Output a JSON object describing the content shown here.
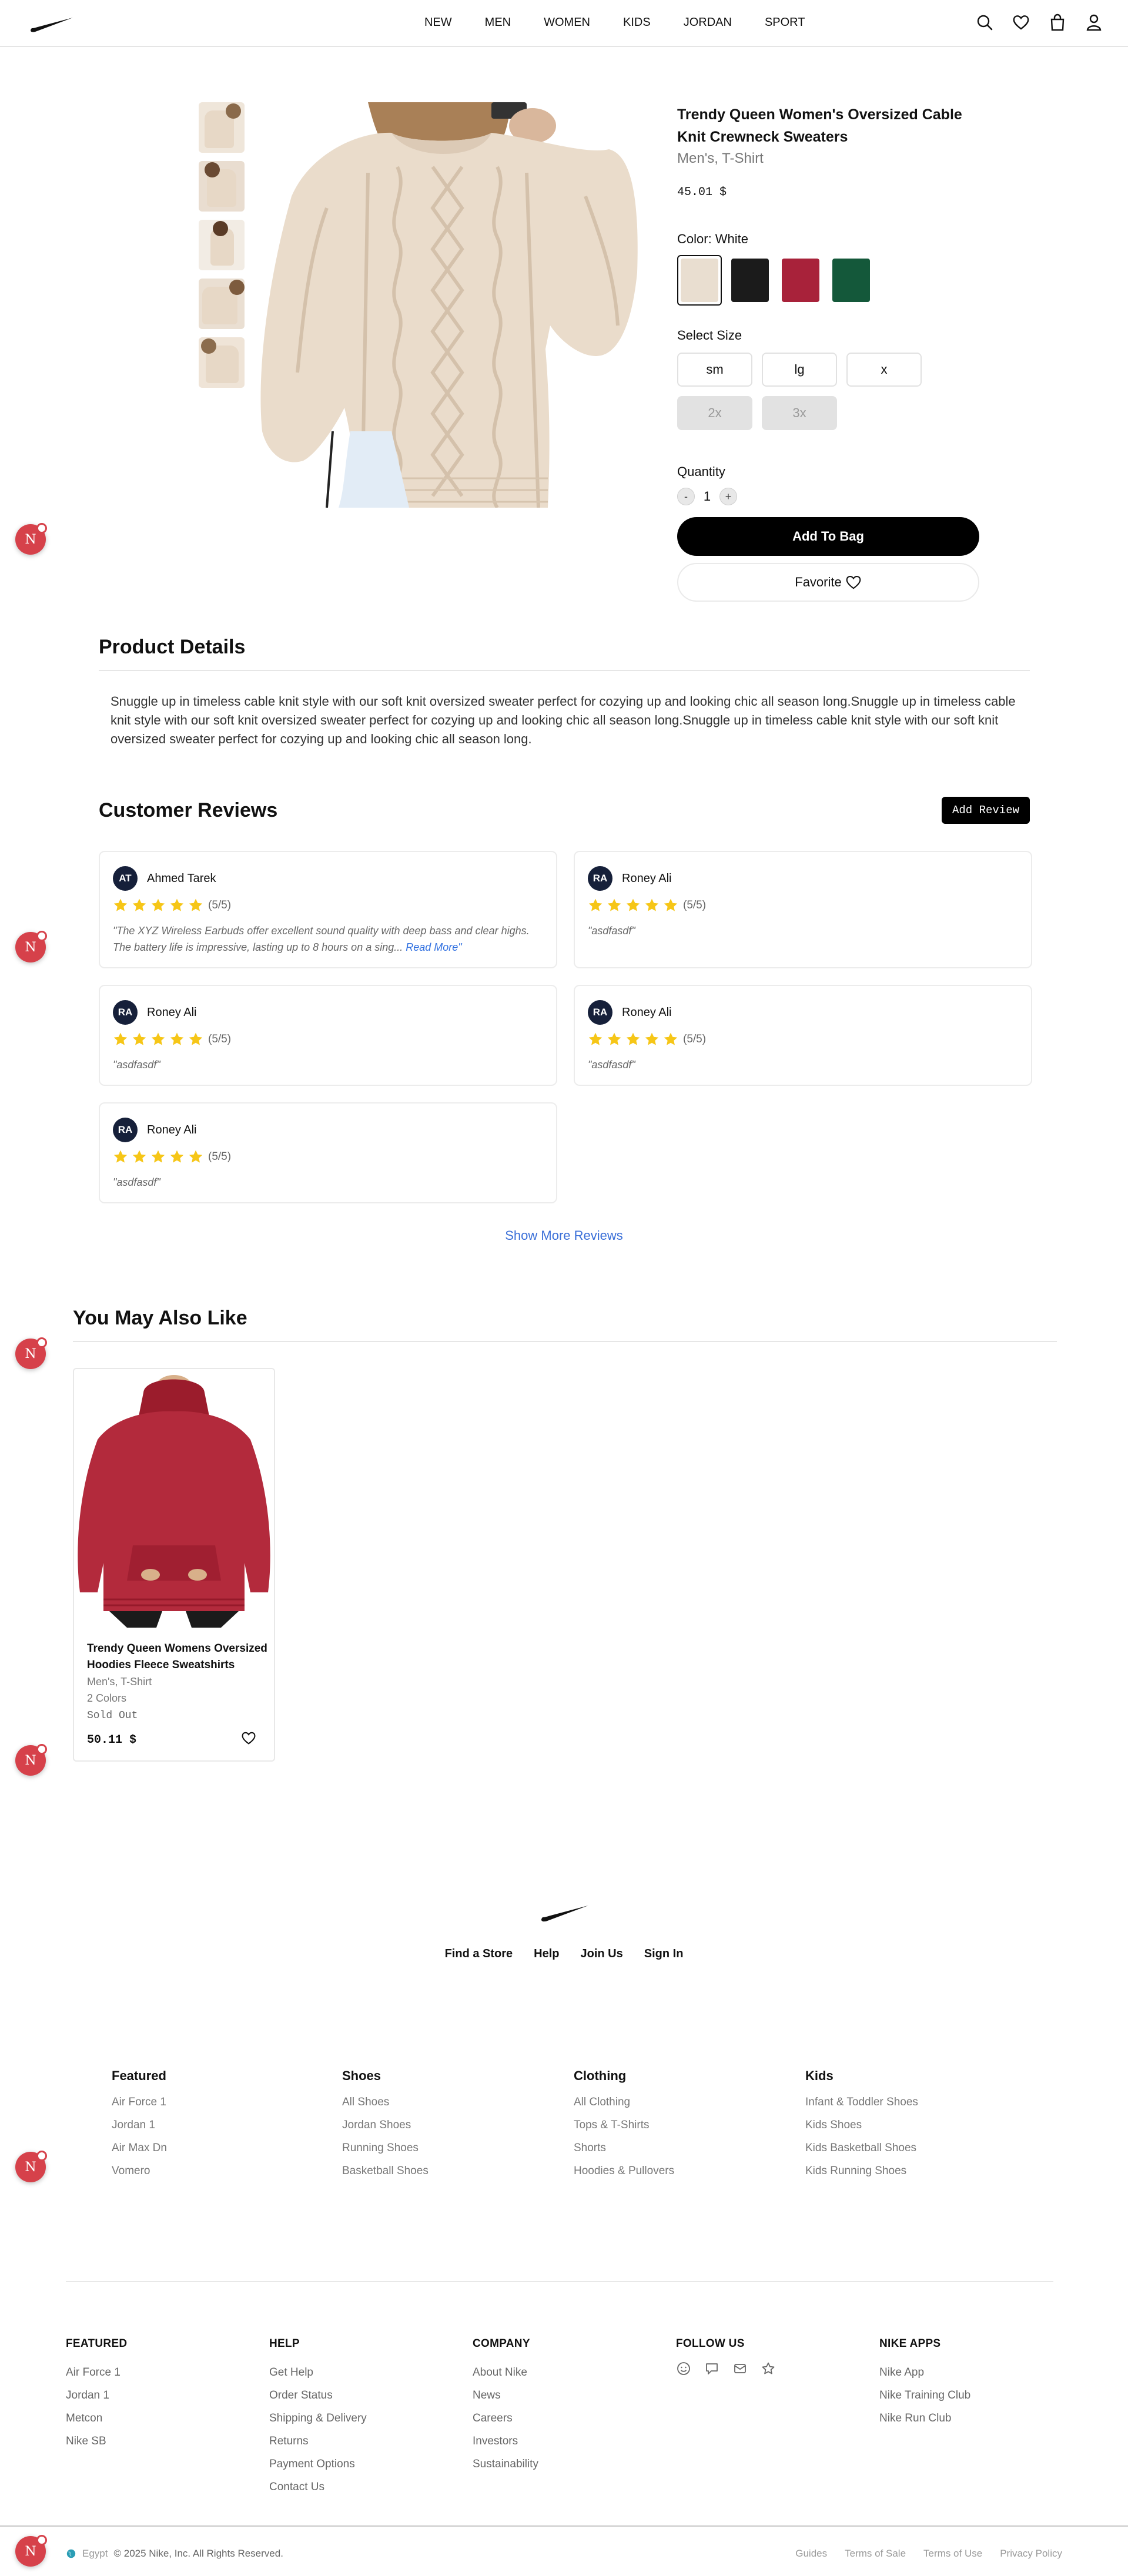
{
  "header": {
    "nav": [
      "NEW",
      "MEN",
      "WOMEN",
      "KIDS",
      "JORDAN",
      "SPORT"
    ],
    "icons": [
      "search-icon",
      "heart-icon",
      "bag-icon",
      "user-icon"
    ]
  },
  "badge": {
    "letter": "N"
  },
  "product": {
    "title": "Trendy Queen Women's Oversized Cable Knit Crewneck Sweaters",
    "category": "Men's, T-Shirt",
    "price": "45.01 $",
    "color_label": "Color: White",
    "colors": [
      {
        "name": "White",
        "hex": "#e9ded0",
        "selected": true
      },
      {
        "name": "Black",
        "hex": "#1b1b1b",
        "selected": false
      },
      {
        "name": "Red",
        "hex": "#a8223a",
        "selected": false
      },
      {
        "name": "Green",
        "hex": "#14583a",
        "selected": false
      }
    ],
    "size_label": "Select Size",
    "sizes": [
      {
        "label": "sm",
        "disabled": false
      },
      {
        "label": "lg",
        "disabled": false
      },
      {
        "label": "x",
        "disabled": false
      },
      {
        "label": "2x",
        "disabled": true
      },
      {
        "label": "3x",
        "disabled": true
      }
    ],
    "quantity_label": "Quantity",
    "quantity": "1",
    "minus": "-",
    "plus": "+",
    "add_to_bag": "Add To Bag",
    "favorite": "Favorite"
  },
  "details": {
    "title": "Product Details",
    "description": "Snuggle up in timeless cable knit style with our soft knit oversized sweater perfect for cozying up and looking chic all season long.Snuggle up in timeless cable knit style with our soft knit oversized sweater perfect for cozying up and looking chic all season long.Snuggle up in timeless cable knit style with our soft knit oversized sweater perfect for cozying up and looking chic all season long."
  },
  "reviews": {
    "title": "Customer Reviews",
    "add_button": "Add Review",
    "items": [
      {
        "initials": "AT",
        "name": "Ahmed Tarek",
        "rating": 5,
        "score": "(5/5)",
        "text": "\"The XYZ Wireless Earbuds offer excellent sound quality with deep bass and clear highs. The battery life is impressive, lasting up to 8 hours on a sing...",
        "read_more": "Read More\""
      },
      {
        "initials": "RA",
        "name": "Roney Ali",
        "rating": 5,
        "score": "(5/5)",
        "text": "\"asdfasdf\"",
        "read_more": ""
      },
      {
        "initials": "RA",
        "name": "Roney Ali",
        "rating": 5,
        "score": "(5/5)",
        "text": "\"asdfasdf\"",
        "read_more": ""
      },
      {
        "initials": "RA",
        "name": "Roney Ali",
        "rating": 5,
        "score": "(5/5)",
        "text": "\"asdfasdf\"",
        "read_more": ""
      },
      {
        "initials": "RA",
        "name": "Roney Ali",
        "rating": 5,
        "score": "(5/5)",
        "text": "\"asdfasdf\"",
        "read_more": ""
      }
    ],
    "show_more": "Show More Reviews"
  },
  "related": {
    "title": "You May Also Like",
    "items": [
      {
        "name": "Trendy Queen Womens Oversized Hoodies Fleece Sweatshirts",
        "category": "Men's, T-Shirt",
        "colors": "2 Colors",
        "status": "Sold Out",
        "price": "50.11 $"
      }
    ]
  },
  "footer": {
    "top_links": [
      "Find a Store",
      "Help",
      "Join Us",
      "Sign In"
    ],
    "columns": [
      {
        "title": "Featured",
        "items": [
          "Air Force 1",
          "Jordan 1",
          "Air Max Dn",
          "Vomero"
        ]
      },
      {
        "title": "Shoes",
        "items": [
          "All Shoes",
          "Jordan Shoes",
          "Running Shoes",
          "Basketball Shoes"
        ]
      },
      {
        "title": "Clothing",
        "items": [
          "All Clothing",
          "Tops & T-Shirts",
          "Shorts",
          "Hoodies & Pullovers"
        ]
      },
      {
        "title": "Kids",
        "items": [
          "Infant & Toddler Shoes",
          "Kids Shoes",
          "Kids Basketball Shoes",
          "Kids Running Shoes"
        ]
      }
    ],
    "bottom_columns": [
      {
        "title": "FEATURED",
        "items": [
          "Air Force 1",
          "Jordan 1",
          "Metcon",
          "Nike SB"
        ]
      },
      {
        "title": "HELP",
        "items": [
          "Get Help",
          "Order Status",
          "Shipping & Delivery",
          "Returns",
          "Payment Options",
          "Contact Us"
        ]
      },
      {
        "title": "COMPANY",
        "items": [
          "About Nike",
          "News",
          "Careers",
          "Investors",
          "Sustainability"
        ]
      },
      {
        "title": "FOLLOW US",
        "items": []
      },
      {
        "title": "NIKE APPS",
        "items": [
          "Nike App",
          "Nike Training Club",
          "Nike Run Club"
        ]
      }
    ],
    "social_icons": [
      "smiley-icon",
      "chat-icon",
      "mail-icon",
      "star-icon"
    ],
    "country": "Egypt",
    "copyright": "© 2025 Nike, Inc. All Rights Reserved.",
    "legal": [
      "Guides",
      "Terms of Sale",
      "Terms of Use",
      "Privacy Policy"
    ]
  }
}
